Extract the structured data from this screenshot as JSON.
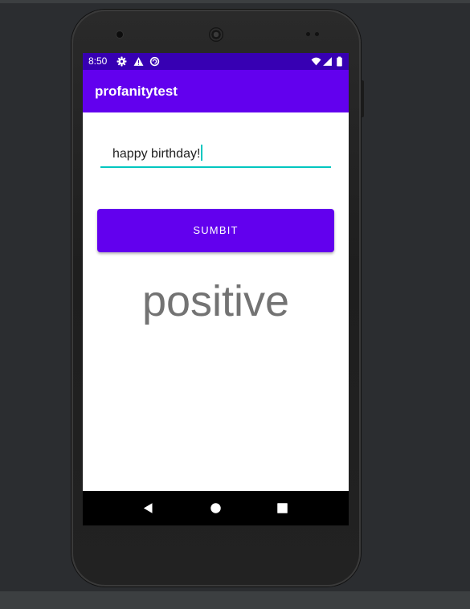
{
  "status_bar": {
    "time": "8:50",
    "icons": [
      "settings-icon",
      "warning-icon",
      "data-saver-icon",
      "wifi-icon",
      "signal-icon",
      "battery-icon"
    ]
  },
  "app_bar": {
    "title": "profanitytest"
  },
  "input": {
    "value": "happy birthday!"
  },
  "submit_button": {
    "label": "SUMBIT"
  },
  "result": {
    "text": "positive"
  },
  "nav_bar": {
    "icons": [
      "back-icon",
      "home-icon",
      "recents-icon"
    ]
  },
  "colors": {
    "primary": "#6200ee",
    "primary_dark": "#3700b3",
    "accent": "#03c7c0",
    "result_text": "#737373"
  }
}
